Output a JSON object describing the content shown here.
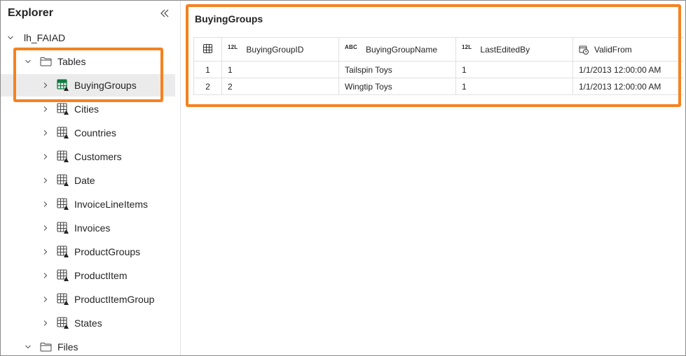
{
  "explorer": {
    "title": "Explorer",
    "lakehouse": "lh_FAIAD",
    "tables_folder": "Tables",
    "files_folder": "Files",
    "tables": [
      "BuyingGroups",
      "Cities",
      "Countries",
      "Customers",
      "Date",
      "InvoiceLineItems",
      "Invoices",
      "ProductGroups",
      "ProductItem",
      "ProductItemGroup",
      "States"
    ],
    "selected_table": "BuyingGroups"
  },
  "preview": {
    "title": "BuyingGroups",
    "columns": [
      {
        "type_tag": "12L",
        "name": "BuyingGroupID"
      },
      {
        "type_tag": "ABC",
        "name": "BuyingGroupName"
      },
      {
        "type_tag": "12L",
        "name": "LastEditedBy"
      },
      {
        "type_tag": "clock",
        "name": "ValidFrom"
      }
    ],
    "rows": [
      {
        "index": "1",
        "cells": [
          "1",
          "Tailspin Toys",
          "1",
          "1/1/2013 12:00:00 AM"
        ]
      },
      {
        "index": "2",
        "cells": [
          "2",
          "Wingtip Toys",
          "1",
          "1/1/2013 12:00:00 AM"
        ]
      }
    ]
  },
  "colors": {
    "highlight": "#f58220",
    "selected_row": "#ebebeb",
    "table_icon_green": "#107c41"
  }
}
